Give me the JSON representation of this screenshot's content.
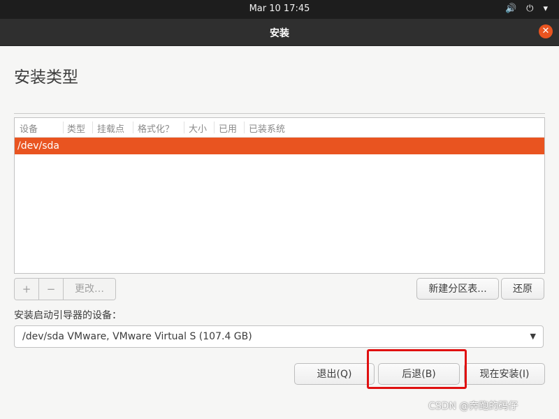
{
  "topbar": {
    "clock": "Mar 10  17:45",
    "icons": [
      "speaker-icon",
      "power-icon",
      "chevron-down-icon"
    ]
  },
  "window": {
    "title": "安装",
    "close_label": "✕"
  },
  "page": {
    "title": "安装类型"
  },
  "table": {
    "columns": [
      "设备",
      "类型",
      "挂载点",
      "格式化？",
      "大小",
      "已用",
      "已装系统"
    ],
    "rows": [
      {
        "device": "/dev/sda"
      }
    ]
  },
  "partition_toolbar": {
    "add_label": "+",
    "remove_label": "−",
    "change_label": "更改…",
    "new_table_label": "新建分区表...",
    "revert_label": "还原"
  },
  "bootloader": {
    "label": "安装启动引导器的设备：",
    "selected": "/dev/sda VMware, VMware Virtual S (107.4 GB)"
  },
  "actions": {
    "quit_label": "退出(Q)",
    "back_label": "后退(B)",
    "install_label": "现在安装(I)"
  },
  "watermark": "CSDN @奔跑的码仔",
  "colors": {
    "accent": "#e95420",
    "highlight": "#e01010"
  }
}
